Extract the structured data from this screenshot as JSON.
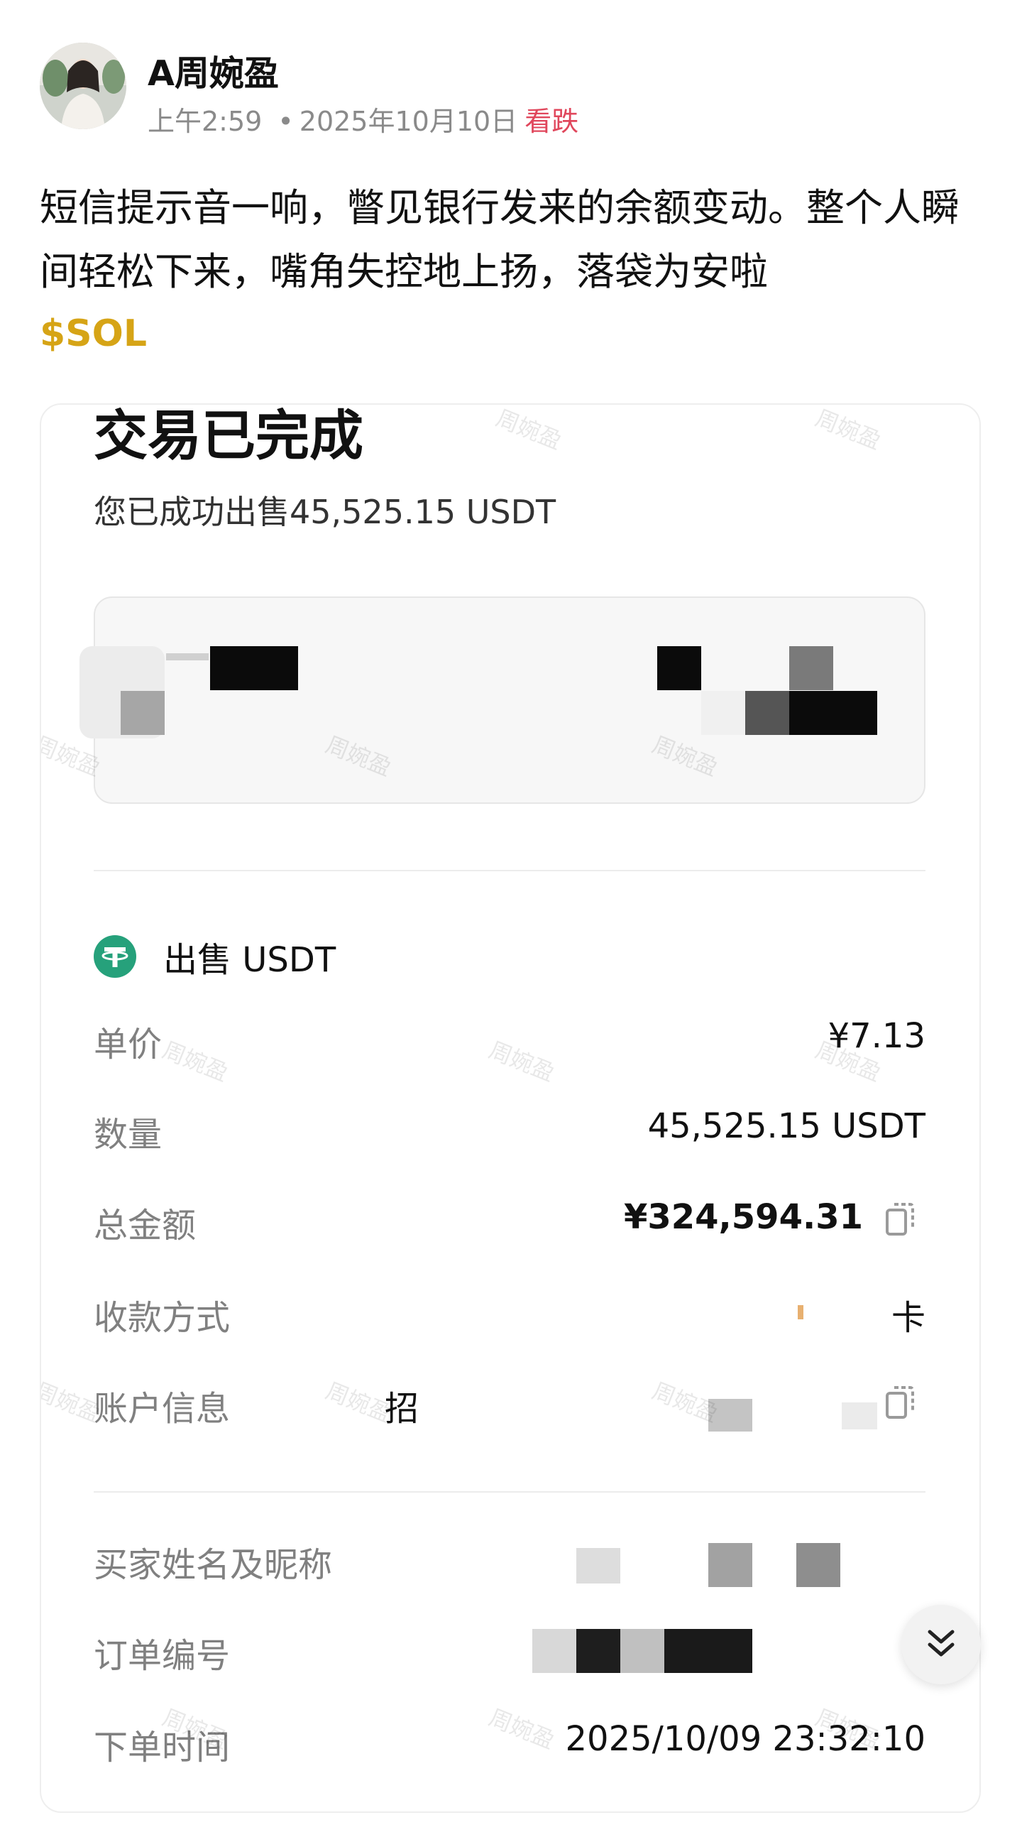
{
  "post": {
    "author": "A周婉盈",
    "time": "上午2:59",
    "separator": "•",
    "date": "2025年10月10日",
    "sentiment": "看跌",
    "text": "短信提示音一响，瞥见银行发来的余额变动。整个人瞬间轻松下来，嘴角失控地上扬，落袋为安啦",
    "ticker": "$SOL"
  },
  "screenshot": {
    "title": "交易已完成",
    "subtitle": "您已成功出售45,525.15 USDT",
    "sell_label": "出售 USDT",
    "rows": [
      {
        "label": "单价",
        "value": "¥7.13"
      },
      {
        "label": "数量",
        "value": "45,525.15 USDT"
      },
      {
        "label": "总金额",
        "value": "¥324,594.31"
      },
      {
        "label": "收款方式",
        "value": "卡"
      },
      {
        "label": "账户信息",
        "value": "招"
      },
      {
        "label": "买家姓名及昵称",
        "value": ""
      },
      {
        "label": "订单编号",
        "value": ""
      },
      {
        "label": "下单时间",
        "value": "2025/10/09 23:32:10"
      }
    ],
    "watermark": "周婉盈"
  },
  "colors": {
    "sentiment": "#e0475c",
    "ticker": "#d6a416",
    "tether": "#26a17b"
  },
  "icons": {
    "tether": "tether-icon",
    "copy": "copy-icon",
    "scroll": "chevron-double-down-icon"
  }
}
